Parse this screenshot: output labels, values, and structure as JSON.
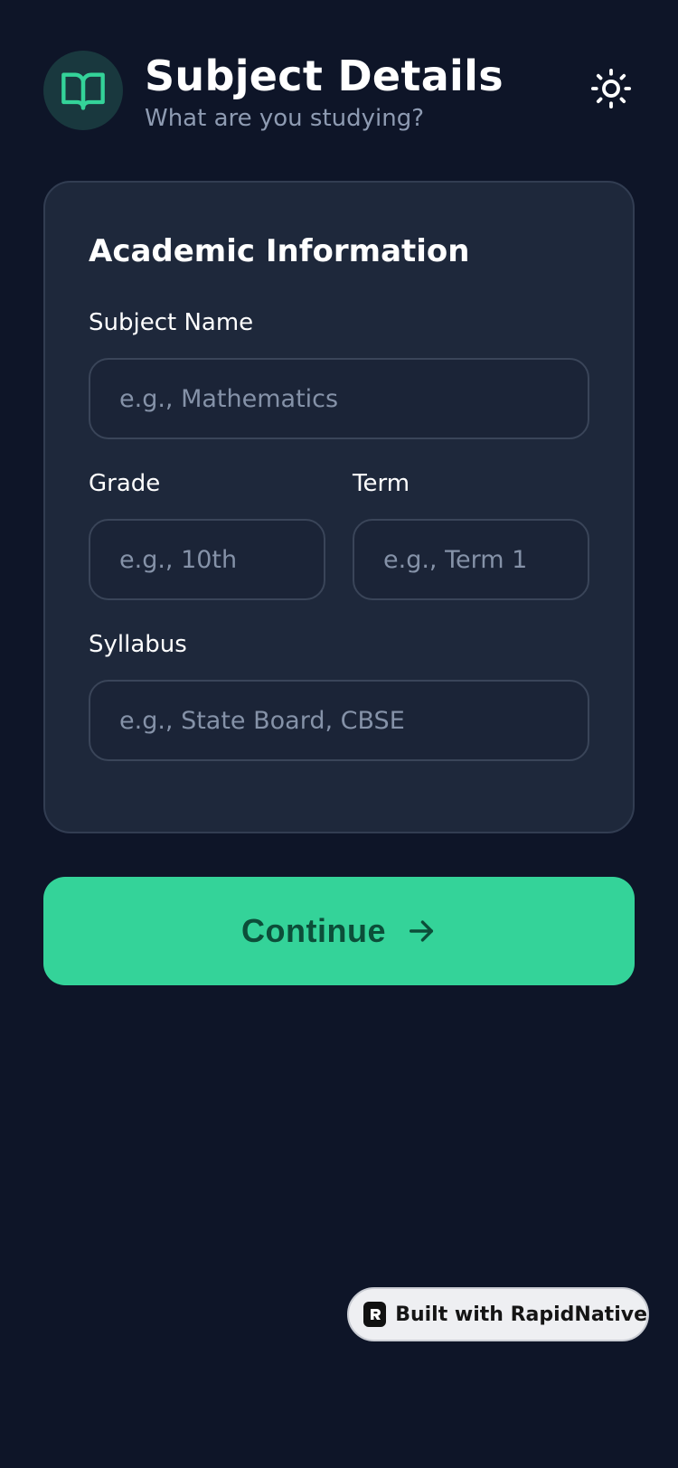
{
  "header": {
    "title": "Subject Details",
    "subtitle": "What are you studying?",
    "icon": "book-open-icon",
    "theme_toggle_icon": "sun-icon"
  },
  "form": {
    "section_title": "Academic Information",
    "subject": {
      "label": "Subject Name",
      "placeholder": "e.g., Mathematics",
      "value": ""
    },
    "grade": {
      "label": "Grade",
      "placeholder": "e.g., 10th",
      "value": ""
    },
    "term": {
      "label": "Term",
      "placeholder": "e.g., Term 1",
      "value": ""
    },
    "syllabus": {
      "label": "Syllabus",
      "placeholder": "e.g., State Board, CBSE",
      "value": ""
    }
  },
  "actions": {
    "continue_label": "Continue",
    "continue_icon": "arrow-right-icon"
  },
  "badge": {
    "label": "Built with RapidNative",
    "icon": "rapidnative-logo-icon"
  },
  "colors": {
    "background": "#0e1528",
    "card": "#1e283b",
    "accent": "#34d399",
    "accent_text": "#0c4e39",
    "muted_text": "#8e9bb2"
  }
}
